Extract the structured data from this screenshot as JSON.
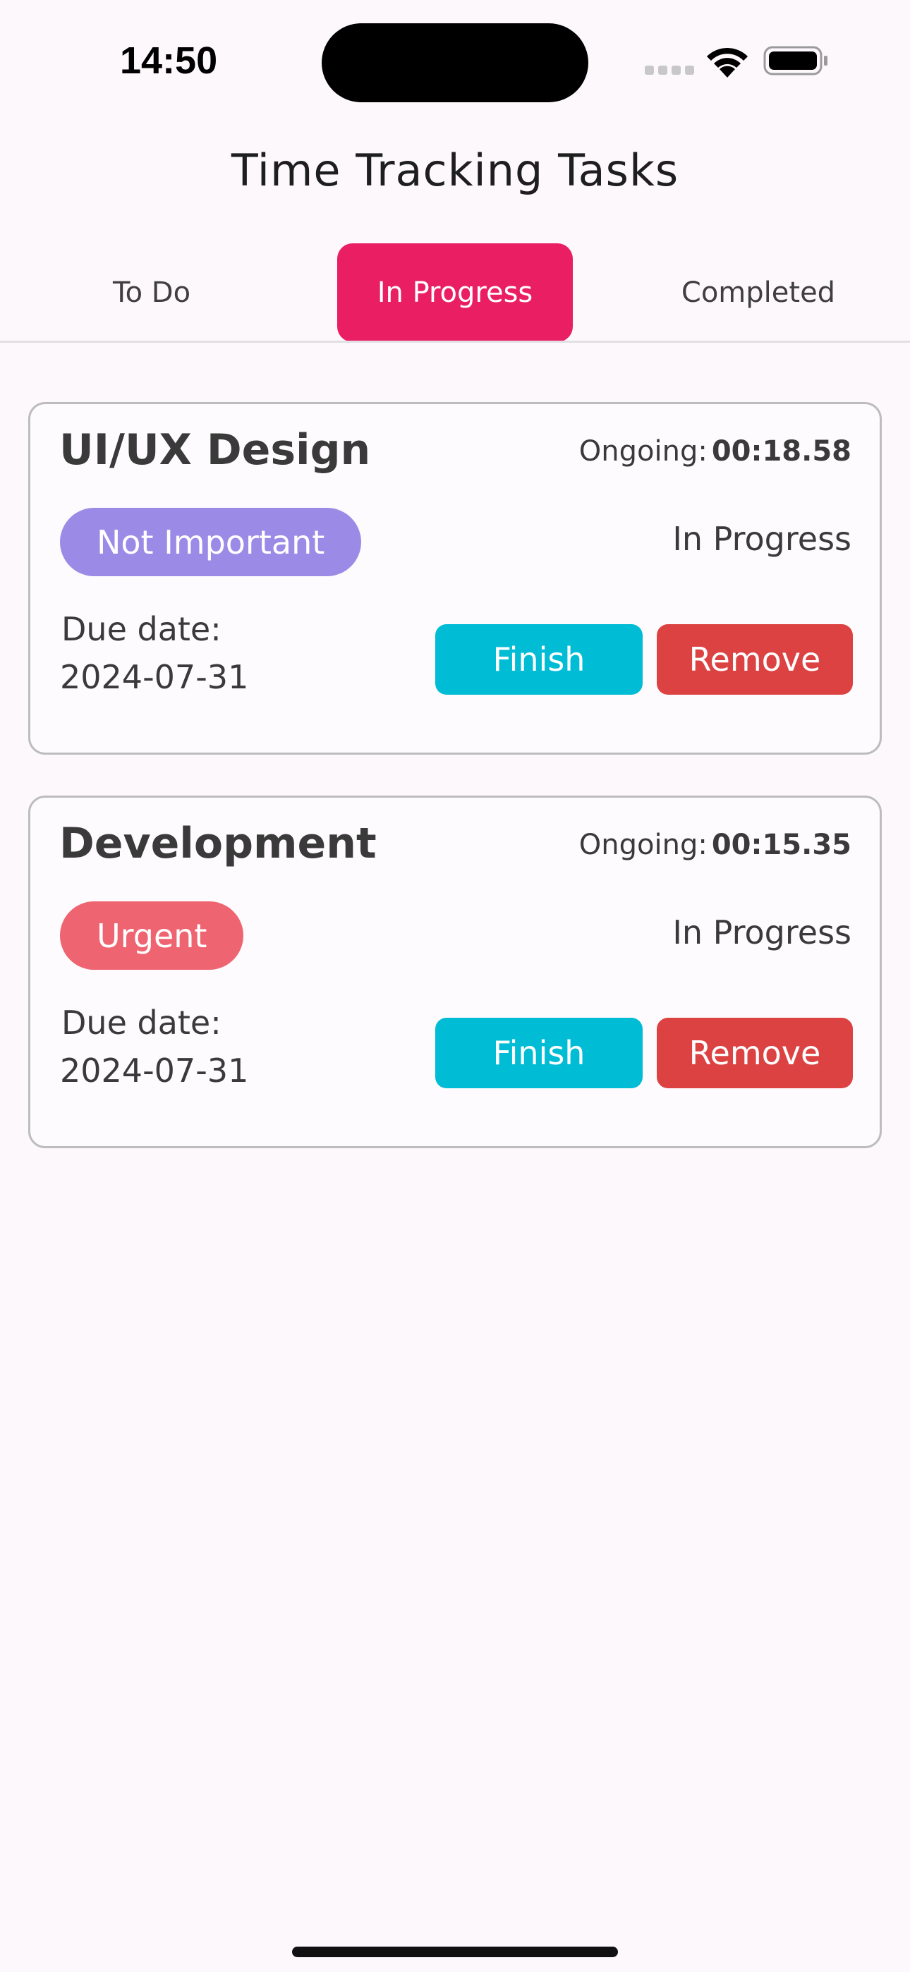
{
  "status_bar": {
    "time": "14:50"
  },
  "header": {
    "title": "Time Tracking Tasks"
  },
  "tabs": [
    {
      "label": "To Do",
      "active": false
    },
    {
      "label": "In Progress",
      "active": true
    },
    {
      "label": "Completed",
      "active": false
    }
  ],
  "colors": {
    "accent": "#e91e63",
    "finish": "#00bcd4",
    "remove": "#dc4242",
    "not_important": "#9c8be6",
    "urgent": "#ee6470"
  },
  "tasks": [
    {
      "title": "UI/UX Design",
      "ongoing_label": "Ongoing:",
      "ongoing_time": "00:18.58",
      "priority": "Not Important",
      "priority_color": "#9c8be6",
      "status": "In Progress",
      "due_label": "Due date:",
      "due_date": "2024-07-31",
      "finish_label": "Finish",
      "remove_label": "Remove"
    },
    {
      "title": "Development",
      "ongoing_label": "Ongoing:",
      "ongoing_time": "00:15.35",
      "priority": "Urgent",
      "priority_color": "#ee6470",
      "status": "In Progress",
      "due_label": "Due date:",
      "due_date": "2024-07-31",
      "finish_label": "Finish",
      "remove_label": "Remove"
    }
  ]
}
